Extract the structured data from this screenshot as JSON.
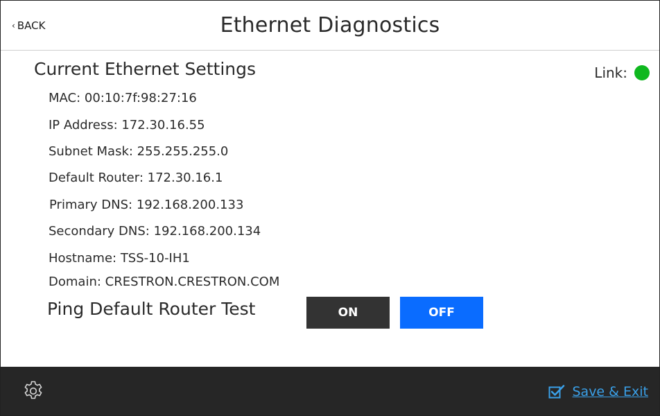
{
  "header": {
    "back_label": "BACK",
    "title": "Ethernet Diagnostics"
  },
  "settings": {
    "section_title": "Current Ethernet Settings",
    "link_label": "Link:",
    "link_status_color": "#0fb81f",
    "mac": "MAC: 00:10:7f:98:27:16",
    "ip_address": "IP Address: 172.30.16.55",
    "subnet_mask": "Subnet Mask: 255.255.255.0",
    "default_router": "Default Router: 172.30.16.1",
    "primary_dns": "Primary DNS: 192.168.200.133",
    "secondary_dns": "Secondary DNS: 192.168.200.134",
    "hostname": "Hostname: TSS-10-IH1",
    "domain": "Domain: CRESTRON.CRESTRON.COM"
  },
  "ping": {
    "label": "Ping Default Router Test",
    "on_label": "ON",
    "off_label": "OFF",
    "selected": "OFF",
    "selected_color": "#0a6cff",
    "unselected_color": "#333333"
  },
  "footer": {
    "settings_icon": "gear-icon",
    "save_icon": "checkbox-check-icon",
    "save_label": "Save & Exit",
    "save_color": "#3aa0e8"
  }
}
